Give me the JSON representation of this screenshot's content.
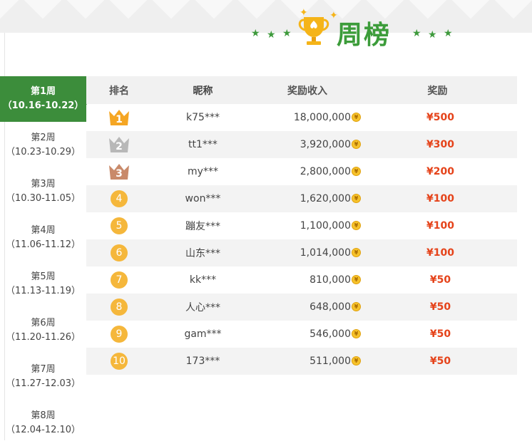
{
  "header": {
    "title": "周榜"
  },
  "sidebar": {
    "weeks": [
      {
        "label": "第1周",
        "range": "（10.16-10.22）",
        "active": true
      },
      {
        "label": "第2周",
        "range": "（10.23-10.29）",
        "active": false
      },
      {
        "label": "第3周",
        "range": "（10.30-11.05）",
        "active": false
      },
      {
        "label": "第4周",
        "range": "（11.06-11.12）",
        "active": false
      },
      {
        "label": "第5周",
        "range": "（11.13-11.19）",
        "active": false
      },
      {
        "label": "第6周",
        "range": "（11.20-11.26）",
        "active": false
      },
      {
        "label": "第7周",
        "range": "（11.27-12.03）",
        "active": false
      },
      {
        "label": "第8周",
        "range": "（12.04-12.10）",
        "active": false
      }
    ]
  },
  "table": {
    "headers": {
      "rank": "排名",
      "nickname": "昵称",
      "income": "奖励收入",
      "reward": "奖励"
    },
    "rows": [
      {
        "rank": "1",
        "nickname": "k75***",
        "income": "18,000,000",
        "reward": "¥500"
      },
      {
        "rank": "2",
        "nickname": "tt1***",
        "income": "3,920,000",
        "reward": "¥300"
      },
      {
        "rank": "3",
        "nickname": "my***",
        "income": "2,800,000",
        "reward": "¥200"
      },
      {
        "rank": "4",
        "nickname": "won***",
        "income": "1,620,000",
        "reward": "¥100"
      },
      {
        "rank": "5",
        "nickname": "蹦友***",
        "income": "1,100,000",
        "reward": "¥100"
      },
      {
        "rank": "6",
        "nickname": "山东***",
        "income": "1,014,000",
        "reward": "¥100"
      },
      {
        "rank": "7",
        "nickname": "kk***",
        "income": "810,000",
        "reward": "¥50"
      },
      {
        "rank": "8",
        "nickname": "人心***",
        "income": "648,000",
        "reward": "¥50"
      },
      {
        "rank": "9",
        "nickname": "gam***",
        "income": "546,000",
        "reward": "¥50"
      },
      {
        "rank": "10",
        "nickname": "173***",
        "income": "511,000",
        "reward": "¥50"
      }
    ]
  },
  "colors": {
    "brand_green": "#3c8d3b",
    "title_green": "#3c9c3a",
    "reward_red": "#e5431a",
    "gold": "#f5b73b",
    "silver": "#b8b8b8",
    "bronze": "#c98a6a"
  },
  "icons": {
    "coin": "¥"
  }
}
